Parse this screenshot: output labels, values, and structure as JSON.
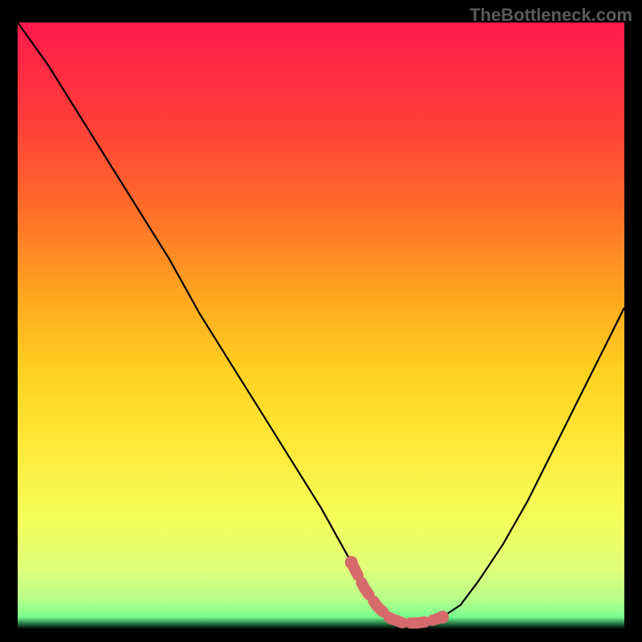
{
  "watermark": "TheBottleneck.com",
  "chart_data": {
    "type": "line",
    "title": "",
    "xlabel": "",
    "ylabel": "",
    "xlim": [
      0,
      100
    ],
    "ylim": [
      0,
      100
    ],
    "series": [
      {
        "name": "bottleneck-curve",
        "x": [
          0,
          5,
          10,
          15,
          20,
          25,
          30,
          35,
          40,
          45,
          50,
          55,
          57,
          59,
          61,
          63,
          65,
          67,
          70,
          73,
          76,
          80,
          84,
          88,
          92,
          96,
          100
        ],
        "y": [
          100,
          93,
          85,
          77,
          69,
          61,
          52,
          44,
          36,
          28,
          20,
          11,
          7,
          4,
          2,
          1,
          1,
          1,
          2,
          4,
          8,
          14,
          21,
          29,
          37,
          45,
          53
        ]
      }
    ],
    "annotations": [
      {
        "name": "optimal-zone",
        "type": "marker-band",
        "x_range": [
          55,
          70
        ],
        "y": 1,
        "color": "#d66a6a"
      }
    ],
    "background_gradient": {
      "stops": [
        {
          "offset": 0.0,
          "color": "#ff1a4d"
        },
        {
          "offset": 0.15,
          "color": "#ff3a3a"
        },
        {
          "offset": 0.3,
          "color": "#ff6a2a"
        },
        {
          "offset": 0.45,
          "color": "#ffa61f"
        },
        {
          "offset": 0.58,
          "color": "#ffd21f"
        },
        {
          "offset": 0.7,
          "color": "#ffe93a"
        },
        {
          "offset": 0.82,
          "color": "#f4ff5a"
        },
        {
          "offset": 0.9,
          "color": "#e0ff7a"
        },
        {
          "offset": 0.95,
          "color": "#b8ff8a"
        },
        {
          "offset": 0.98,
          "color": "#7aff8f"
        },
        {
          "offset": 1.0,
          "color": "#3cff9c",
          "alpha": 0
        }
      ]
    }
  }
}
